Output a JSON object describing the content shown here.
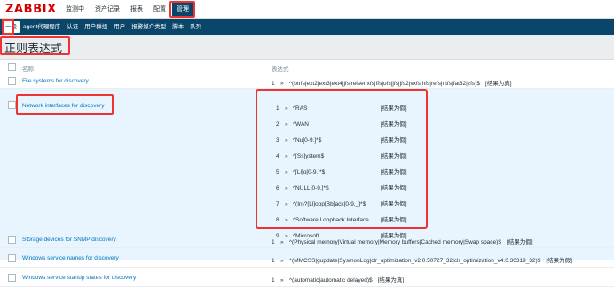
{
  "app": {
    "logo": "ZABBIX"
  },
  "main_nav": [
    {
      "label": "监测中",
      "active": false
    },
    {
      "label": "资产记录",
      "active": false
    },
    {
      "label": "报表",
      "active": false
    },
    {
      "label": "配置",
      "active": false
    },
    {
      "label": "管理",
      "active": true
    }
  ],
  "sub_nav": [
    {
      "label": "一般",
      "active": true
    },
    {
      "label": "agent代理程序",
      "active": false
    },
    {
      "label": "认证",
      "active": false
    },
    {
      "label": "用户群组",
      "active": false
    },
    {
      "label": "用户",
      "active": false
    },
    {
      "label": "报警媒介类型",
      "active": false
    },
    {
      "label": "脚本",
      "active": false
    },
    {
      "label": "队列",
      "active": false
    }
  ],
  "page": {
    "title": "正则表达式"
  },
  "table": {
    "columns": {
      "name": "名称",
      "expressions": "表达式"
    },
    "rows": [
      {
        "name": "File systems for discovery",
        "expressions": [
          {
            "num": "1",
            "pattern": "^(btrfs|ext2|ext3|ext4|jfs|reiser|xfs|ffs|ufs|jfs|jfs2|vxfs|hfs|refs|ntfs|fat32|zfs)$",
            "result": "[结果为真]"
          }
        ]
      },
      {
        "name": "Network interfaces for discovery",
        "expressions": [
          {
            "num": "1",
            "pattern": "^RAS",
            "result": "[结果为假]"
          },
          {
            "num": "2",
            "pattern": "^WAN",
            "result": "[结果为假]"
          },
          {
            "num": "3",
            "pattern": "^Nu[0-9.]*$",
            "result": "[结果为假]"
          },
          {
            "num": "4",
            "pattern": "^[Ss]ystem$",
            "result": "[结果为假]"
          },
          {
            "num": "5",
            "pattern": "^[Ll]o[0-9.]*$",
            "result": "[结果为假]"
          },
          {
            "num": "6",
            "pattern": "^NULL[0-9.]*$",
            "result": "[结果为假]"
          },
          {
            "num": "7",
            "pattern": "^(In)?[Ll]oop[Bb]ack[0-9._]*$",
            "result": "[结果为假]"
          },
          {
            "num": "8",
            "pattern": "^Software Loopback Interface",
            "result": "[结果为假]"
          },
          {
            "num": "9",
            "pattern": "^Microsoft",
            "result": "[结果为假]"
          }
        ]
      },
      {
        "name": "Storage devices for SNMP discovery",
        "expressions": [
          {
            "num": "1",
            "pattern": "^(Physical memory|Virtual memory|Memory buffers|Cached memory|Swap space)$",
            "result": "[结果为假]"
          }
        ]
      },
      {
        "name": "Windows service names for discovery",
        "expressions": [
          {
            "num": "1",
            "pattern": "^(MMCSS|gupdate|SysmonLog|clr_optimization_v2.0.50727_32|clr_optimization_v4.0.30319_32)$",
            "result": "[结果为假]"
          }
        ]
      },
      {
        "name": "Windows service startup states for discovery",
        "expressions": [
          {
            "num": "1",
            "pattern": "^(automatic|automatic delayed)$",
            "result": "[结果为真]"
          }
        ]
      }
    ]
  },
  "colors": {
    "nav_dark": "#0a466a",
    "link": "#0275b8",
    "logo": "#d40000",
    "highlight_row": "#e8f5ff",
    "annotation": "#ee3333"
  }
}
